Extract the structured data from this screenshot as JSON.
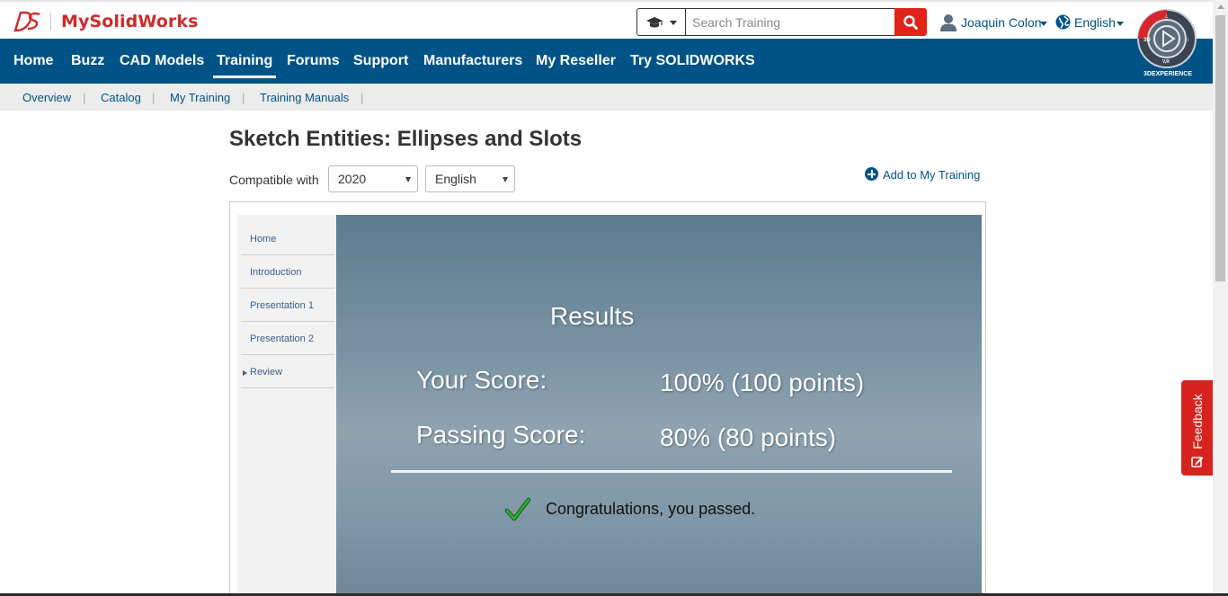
{
  "header": {
    "brand": "MySolidWorks",
    "search_placeholder": "Search Training",
    "user_name": "Joaquin Colon",
    "language": "English",
    "compass_label": "3DEXPERIENCE"
  },
  "nav": {
    "items": [
      "Home",
      "Buzz",
      "CAD Models",
      "Training",
      "Forums",
      "Support",
      "Manufacturers",
      "My Reseller",
      "Try SOLIDWORKS"
    ],
    "active": "Training"
  },
  "subnav": {
    "items": [
      "Overview",
      "Catalog",
      "My Training",
      "Training Manuals"
    ],
    "separator": "|"
  },
  "course": {
    "title": "Sketch Entities: Ellipses and Slots",
    "compatible_label": "Compatible with",
    "version": "2020",
    "language": "English",
    "add_label": "Add to My Training",
    "toc": [
      "Home",
      "Introduction",
      "Presentation 1",
      "Presentation 2",
      "Review"
    ],
    "toc_current": "Review"
  },
  "results": {
    "title": "Results",
    "your_score_label": "Your Score:",
    "your_score_value": "100% (100 points)",
    "passing_score_label": "Passing Score:",
    "passing_score_value": "80% (80 points)",
    "message": "Congratulations, you passed."
  },
  "feedback": {
    "label": "Feedback"
  },
  "colors": {
    "brand_red": "#d12a2a",
    "nav_blue": "#005386",
    "search_button": "#e2231a",
    "feedback": "#d6231f",
    "check_green": "#1f8a1f"
  }
}
